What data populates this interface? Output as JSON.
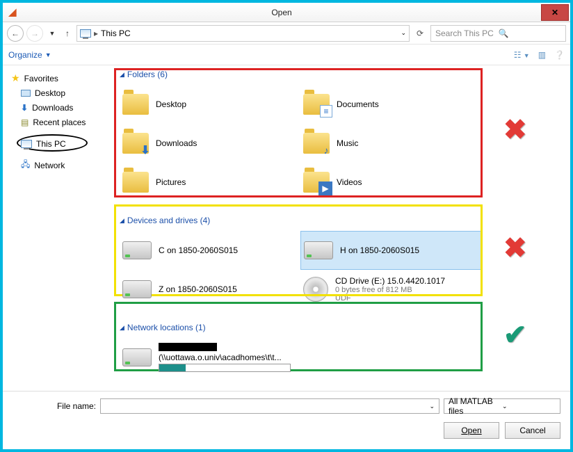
{
  "window": {
    "title": "Open"
  },
  "nav": {
    "breadcrumb": "This PC",
    "search_placeholder": "Search This PC"
  },
  "toolbar": {
    "organize": "Organize"
  },
  "sidebar": {
    "favorites_label": "Favorites",
    "favorites": [
      {
        "label": "Desktop"
      },
      {
        "label": "Downloads"
      },
      {
        "label": "Recent places"
      }
    ],
    "this_pc": "This PC",
    "network": "Network"
  },
  "sections": {
    "folders": {
      "title": "Folders (6)",
      "items": [
        "Desktop",
        "Documents",
        "Downloads",
        "Music",
        "Pictures",
        "Videos"
      ]
    },
    "drives": {
      "title": "Devices and drives (4)",
      "c": "C on 1850-2060S015",
      "h": "H on 1850-2060S015",
      "z": "Z on 1850-2060S015",
      "cd_name": "CD Drive (E:) 15.0.4420.1017",
      "cd_free": "0 bytes free of 812 MB",
      "cd_fs": "UDF"
    },
    "netloc": {
      "title": "Network locations (1)",
      "path": "(\\\\uottawa.o.univ\\acadhomes\\t\\t..."
    }
  },
  "bottom": {
    "filename_label": "File name:",
    "filter": "All MATLAB files",
    "open": "Open",
    "cancel": "Cancel"
  }
}
